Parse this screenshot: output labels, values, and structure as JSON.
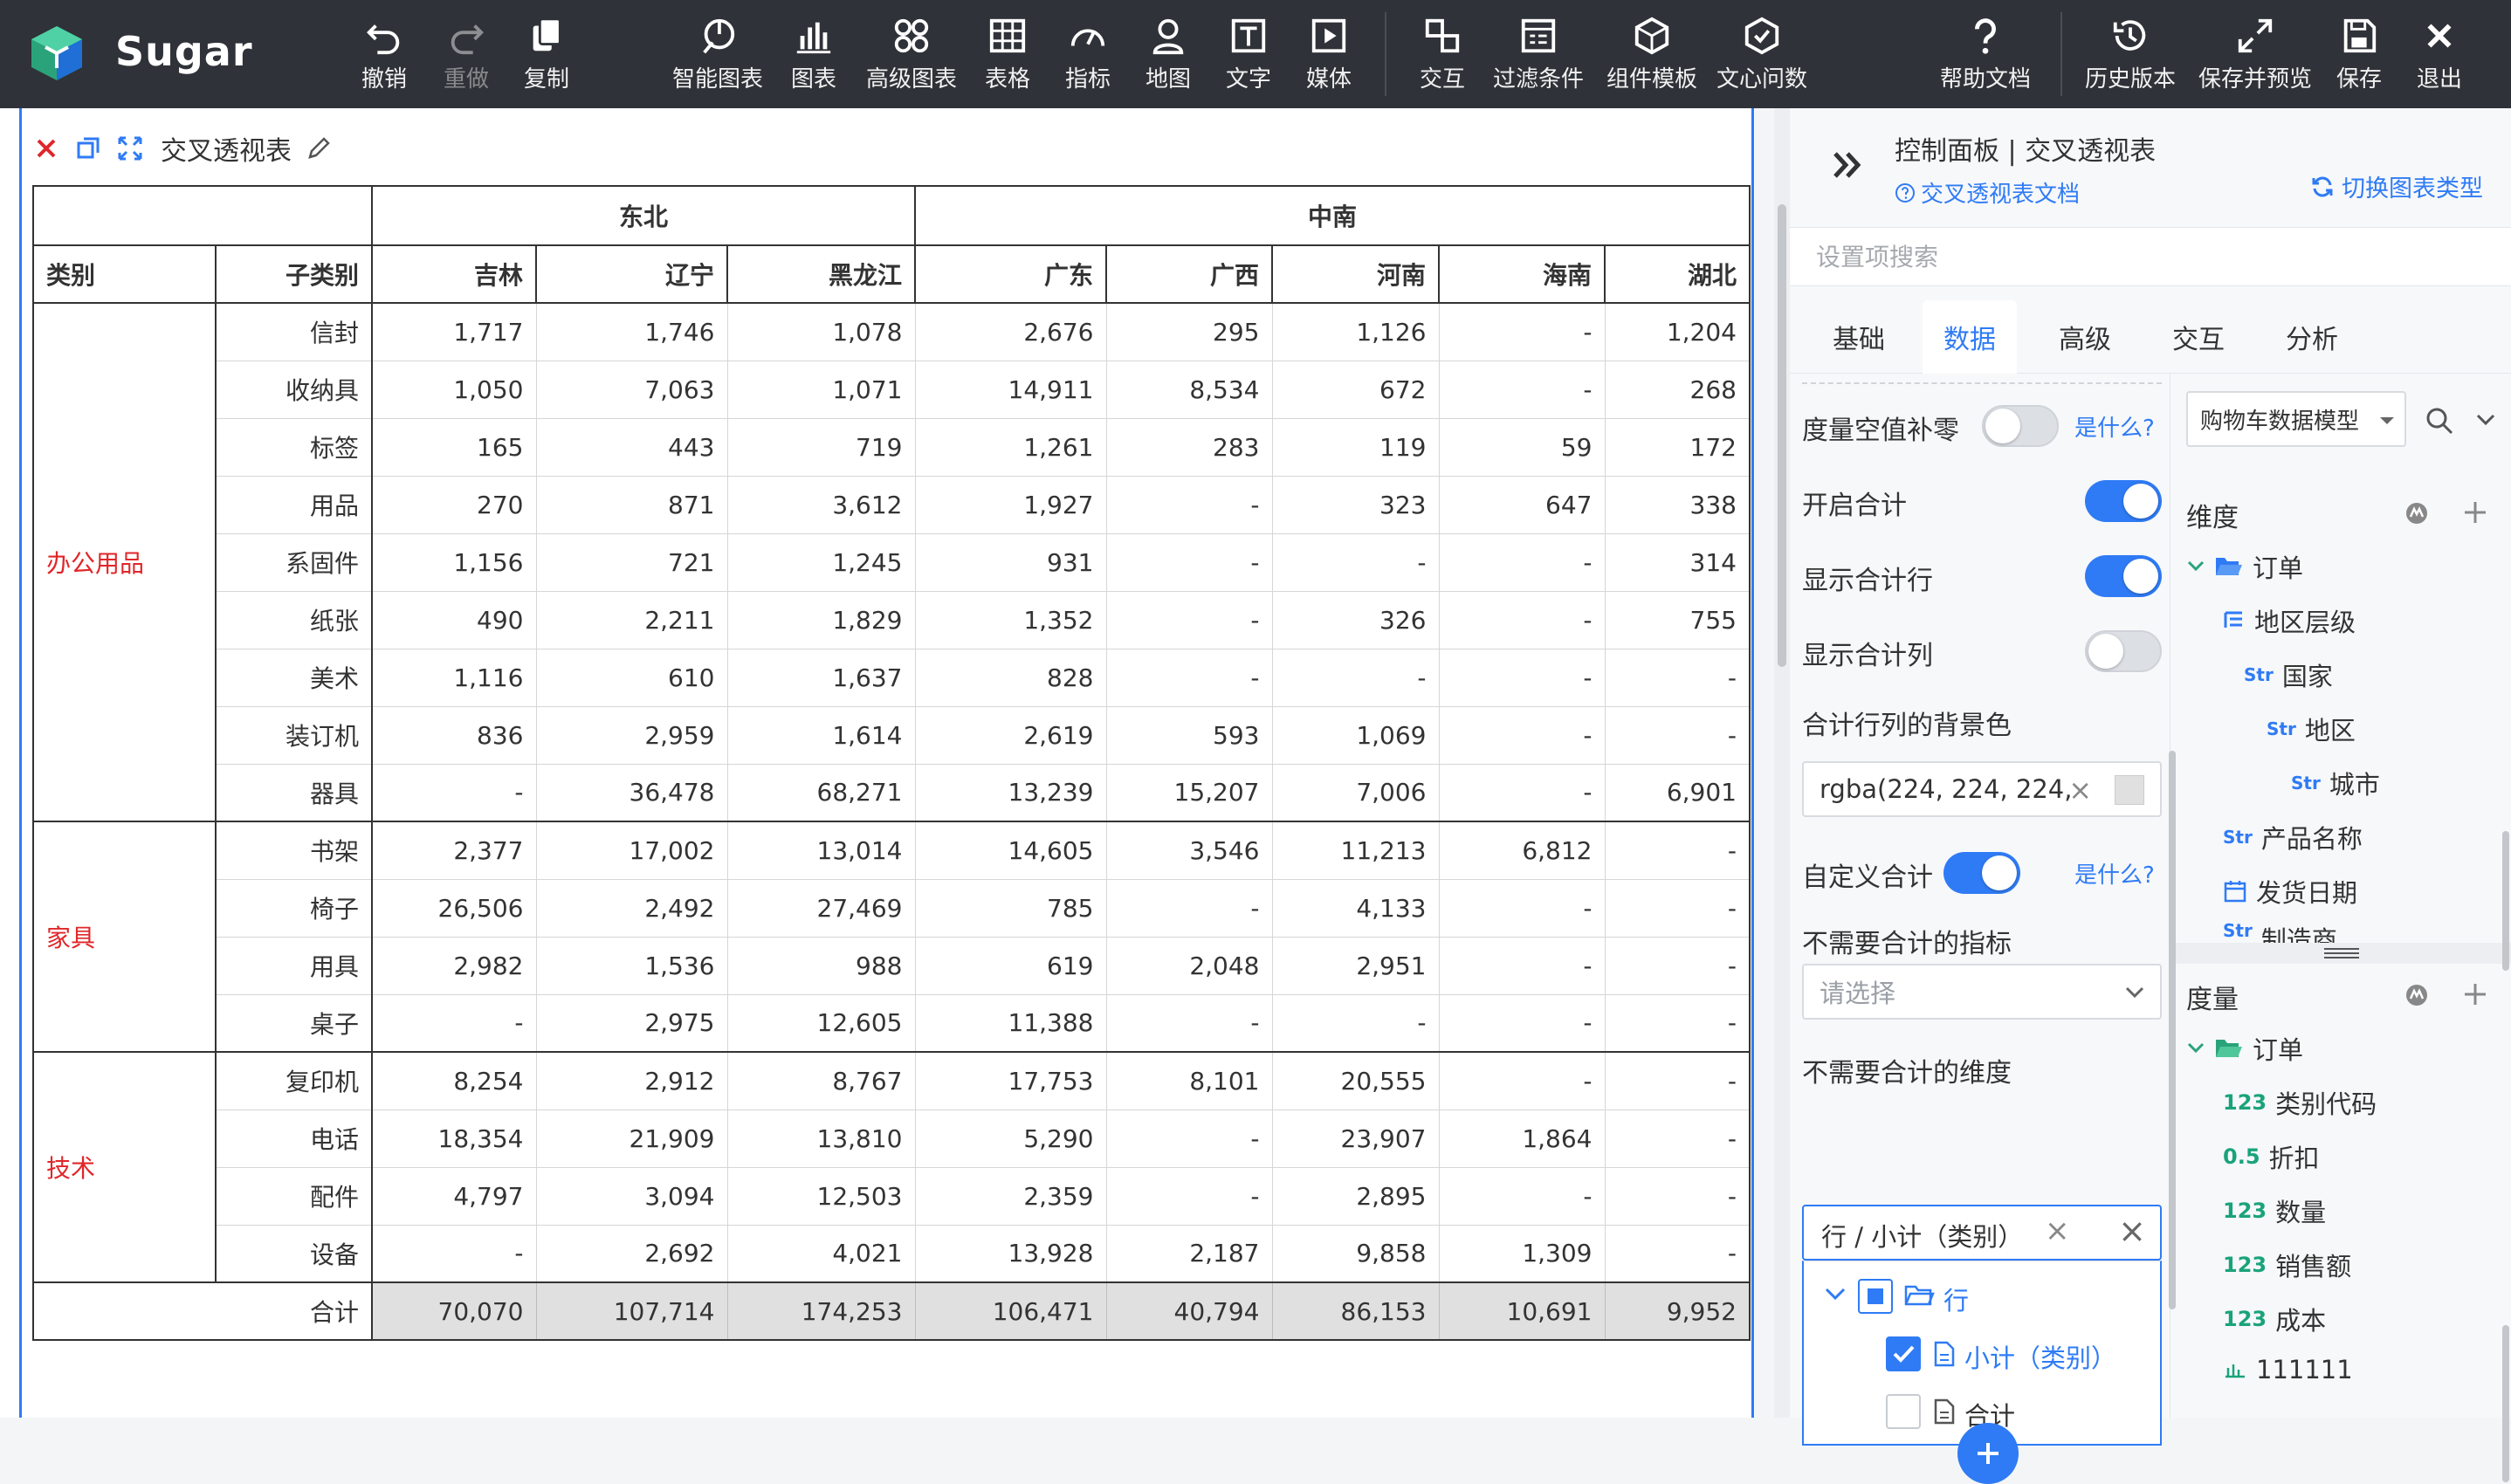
{
  "toolbar": {
    "brand": "Sugar",
    "buttons": [
      {
        "label": "撤销",
        "icon": "undo-icon"
      },
      {
        "label": "重做",
        "icon": "redo-icon"
      },
      {
        "label": "复制",
        "icon": "copy-icon"
      },
      {
        "label": "智能图表",
        "icon": "smart-chart-icon"
      },
      {
        "label": "图表",
        "icon": "chart-icon"
      },
      {
        "label": "高级图表",
        "icon": "advanced-chart-icon"
      },
      {
        "label": "表格",
        "icon": "table-icon"
      },
      {
        "label": "指标",
        "icon": "gauge-icon"
      },
      {
        "label": "地图",
        "icon": "map-pin-icon"
      },
      {
        "label": "文字",
        "icon": "text-icon"
      },
      {
        "label": "媒体",
        "icon": "media-icon"
      },
      {
        "label": "交互",
        "icon": "interaction-icon"
      },
      {
        "label": "过滤条件",
        "icon": "filter-icon"
      },
      {
        "label": "组件模板",
        "icon": "template-icon"
      },
      {
        "label": "文心问数",
        "icon": "ai-ask-icon"
      },
      {
        "label": "帮助文档",
        "icon": "help-icon"
      },
      {
        "label": "历史版本",
        "icon": "history-icon"
      },
      {
        "label": "保存并预览",
        "icon": "expand-icon"
      },
      {
        "label": "保存",
        "icon": "save-icon"
      },
      {
        "label": "退出",
        "icon": "close-icon"
      }
    ]
  },
  "widget": {
    "title": "交叉透视表"
  },
  "pivot": {
    "regions": [
      "东北",
      "中南"
    ],
    "row_headers": [
      "类别",
      "子类别"
    ],
    "columns": [
      "吉林",
      "辽宁",
      "黑龙江",
      "广东",
      "广西",
      "河南",
      "海南",
      "湖北"
    ],
    "groups": [
      {
        "category": "办公用品",
        "rows": [
          {
            "sub": "信封",
            "values": [
              "1,717",
              "1,746",
              "1,078",
              "2,676",
              "295",
              "1,126",
              "-",
              "1,204"
            ]
          },
          {
            "sub": "收纳具",
            "values": [
              "1,050",
              "7,063",
              "1,071",
              "14,911",
              "8,534",
              "672",
              "-",
              "268"
            ]
          },
          {
            "sub": "标签",
            "values": [
              "165",
              "443",
              "719",
              "1,261",
              "283",
              "119",
              "59",
              "172"
            ]
          },
          {
            "sub": "用品",
            "values": [
              "270",
              "871",
              "3,612",
              "1,927",
              "-",
              "323",
              "647",
              "338"
            ]
          },
          {
            "sub": "系固件",
            "values": [
              "1,156",
              "721",
              "1,245",
              "931",
              "-",
              "-",
              "-",
              "314"
            ]
          },
          {
            "sub": "纸张",
            "values": [
              "490",
              "2,211",
              "1,829",
              "1,352",
              "-",
              "326",
              "-",
              "755"
            ]
          },
          {
            "sub": "美术",
            "values": [
              "1,116",
              "610",
              "1,637",
              "828",
              "-",
              "-",
              "-",
              "-"
            ]
          },
          {
            "sub": "装订机",
            "values": [
              "836",
              "2,959",
              "1,614",
              "2,619",
              "593",
              "1,069",
              "-",
              "-"
            ]
          },
          {
            "sub": "器具",
            "values": [
              "-",
              "36,478",
              "68,271",
              "13,239",
              "15,207",
              "7,006",
              "-",
              "6,901"
            ]
          }
        ]
      },
      {
        "category": "家具",
        "rows": [
          {
            "sub": "书架",
            "values": [
              "2,377",
              "17,002",
              "13,014",
              "14,605",
              "3,546",
              "11,213",
              "6,812",
              "-"
            ]
          },
          {
            "sub": "椅子",
            "values": [
              "26,506",
              "2,492",
              "27,469",
              "785",
              "-",
              "4,133",
              "-",
              "-"
            ]
          },
          {
            "sub": "用具",
            "values": [
              "2,982",
              "1,536",
              "988",
              "619",
              "2,048",
              "2,951",
              "-",
              "-"
            ]
          },
          {
            "sub": "桌子",
            "values": [
              "-",
              "2,975",
              "12,605",
              "11,388",
              "-",
              "-",
              "-",
              "-"
            ]
          }
        ]
      },
      {
        "category": "技术",
        "rows": [
          {
            "sub": "复印机",
            "values": [
              "8,254",
              "2,912",
              "8,767",
              "17,753",
              "8,101",
              "20,555",
              "-",
              "-"
            ]
          },
          {
            "sub": "电话",
            "values": [
              "18,354",
              "21,909",
              "13,810",
              "5,290",
              "-",
              "23,907",
              "1,864",
              "-"
            ]
          },
          {
            "sub": "配件",
            "values": [
              "4,797",
              "3,094",
              "12,503",
              "2,359",
              "-",
              "2,895",
              "-",
              "-"
            ]
          },
          {
            "sub": "设备",
            "values": [
              "-",
              "2,692",
              "4,021",
              "13,928",
              "2,187",
              "9,858",
              "1,309",
              "-"
            ]
          }
        ]
      }
    ],
    "total_label": "合计",
    "totals": [
      "70,070",
      "107,714",
      "174,253",
      "106,471",
      "40,794",
      "86,153",
      "10,691",
      "9,952"
    ]
  },
  "panel": {
    "title": "控制面板 | 交叉透视表",
    "doc_link": "交叉透视表文档",
    "switch_link": "切换图表类型",
    "search_placeholder": "设置项搜索",
    "tabs": [
      "基础",
      "数据",
      "高级",
      "交互",
      "分析"
    ],
    "active_tab": "数据",
    "settings": {
      "null_zero_label": "度量空值补零",
      "what_label": "是什么?",
      "enable_total_label": "开启合计",
      "show_total_row_label": "显示合计行",
      "show_total_col_label": "显示合计列",
      "total_bg_label": "合计行列的背景色",
      "total_bg_value": "rgba(224, 224, 224,",
      "custom_total_label": "自定义合计",
      "no_total_metric_label": "不需要合计的指标",
      "select_placeholder": "请选择",
      "no_total_dim_label": "不需要合计的维度",
      "dim_tag": "行 / 小计（类别）",
      "tree": {
        "root": "行",
        "child1": "小计（类别）",
        "child2": "合计"
      }
    },
    "model": {
      "selected_model": "购物车数据模型",
      "dimension_head": "维度",
      "measure_head": "度量",
      "dim_folder": "订单",
      "dim_items": [
        {
          "tag": "",
          "label": "地区层级"
        },
        {
          "tag": "Str",
          "label": "国家"
        },
        {
          "tag": "Str",
          "label": "地区"
        },
        {
          "tag": "Str",
          "label": "城市"
        },
        {
          "tag": "Str",
          "label": "产品名称"
        },
        {
          "tag": "",
          "label": "发货日期"
        },
        {
          "tag": "Str",
          "label": "制造商"
        }
      ],
      "measure_folder": "订单",
      "measure_items": [
        {
          "tag": "123",
          "label": "类别代码"
        },
        {
          "tag": "0.5",
          "label": "折扣"
        },
        {
          "tag": "123",
          "label": "数量"
        },
        {
          "tag": "123",
          "label": "销售额"
        },
        {
          "tag": "123",
          "label": "成本"
        },
        {
          "tag": "",
          "label": "111111"
        }
      ]
    }
  },
  "colors": {
    "accent": "#2f7bf5",
    "toolbar_bg": "#2f3238",
    "category_red": "#e0262a",
    "total_bg": "#e0e0e0"
  }
}
